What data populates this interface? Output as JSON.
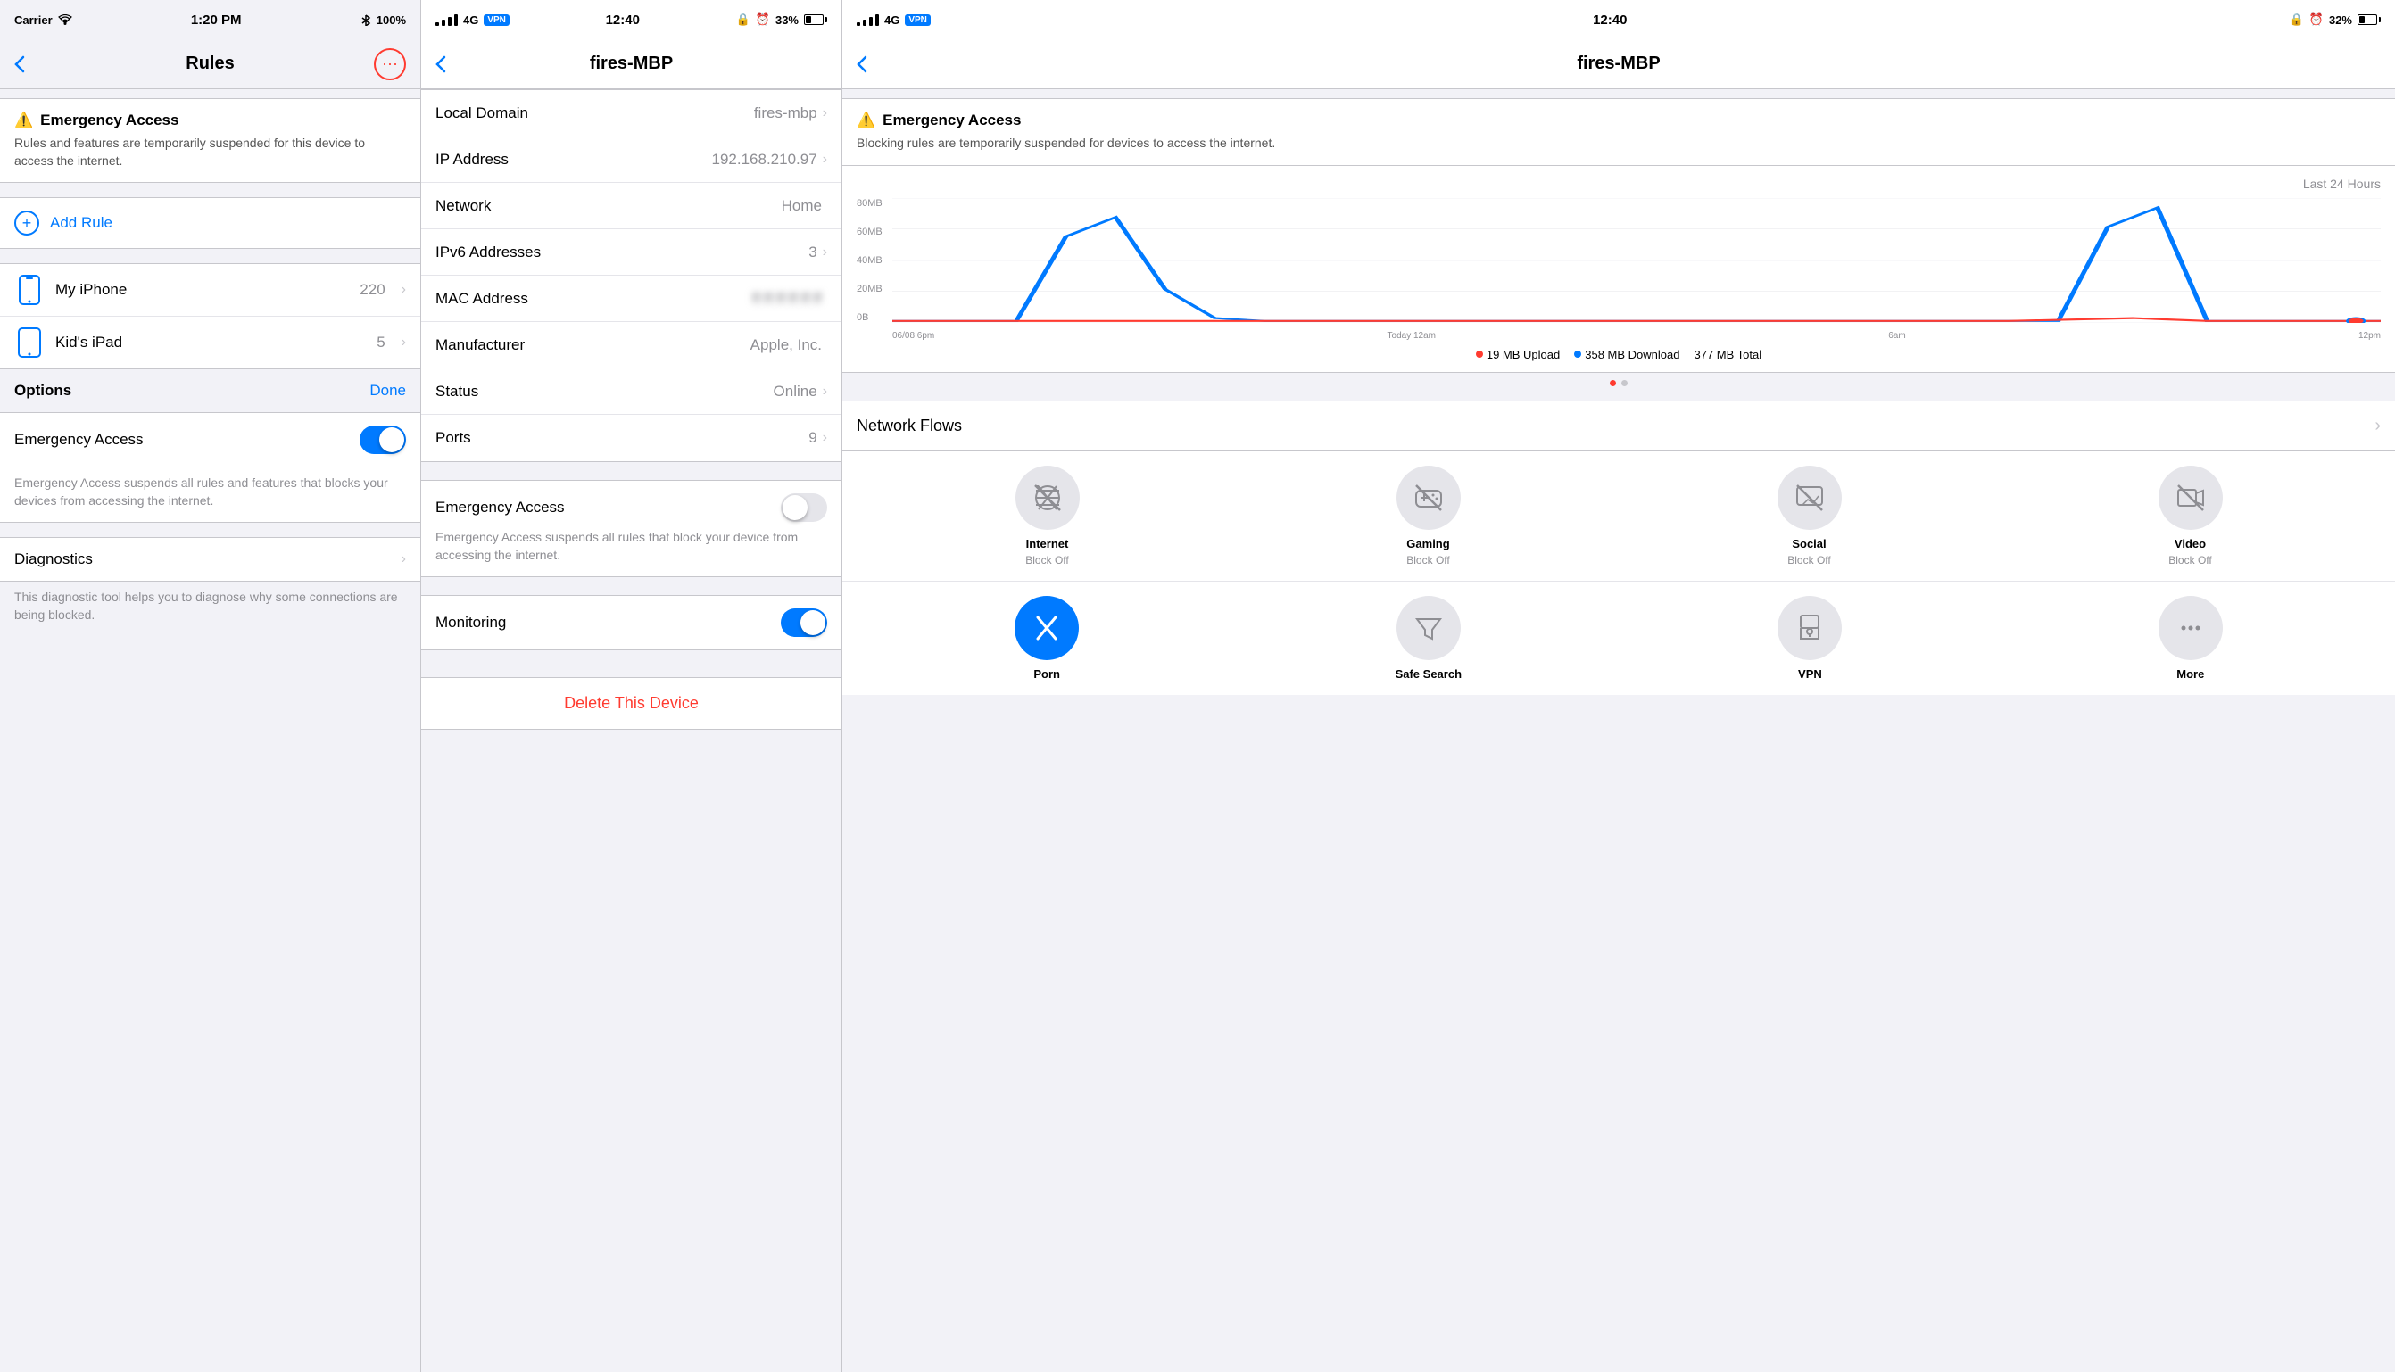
{
  "panel1": {
    "statusBar": {
      "carrier": "Carrier",
      "signal": "●●●●●",
      "wifi": "wifi",
      "time": "1:20 PM",
      "bluetooth": "bluetooth",
      "battery": "100%"
    },
    "navTitle": "Rules",
    "emergencyBanner": {
      "title": "⚠️ Emergency Access",
      "desc": "Rules and features are temporarily suspended for this device to access the internet."
    },
    "addRule": {
      "label": "Add Rule"
    },
    "devices": [
      {
        "name": "My iPhone",
        "icon": "phone",
        "count": "220"
      },
      {
        "name": "Kid's iPad",
        "icon": "tablet",
        "count": "5"
      }
    ],
    "optionsBar": {
      "label": "Options",
      "done": "Done"
    },
    "emergencyAccessSetting": {
      "label": "Emergency Access",
      "desc": "Emergency Access suspends all rules and features that blocks your devices from accessing the internet."
    },
    "diagnostics": {
      "label": "Diagnostics",
      "desc": "This diagnostic tool helps you to diagnose why some connections are being blocked."
    }
  },
  "panel2": {
    "statusBar": {
      "signal": "4G",
      "vpn": "VPN",
      "time": "12:40",
      "battery": "33%"
    },
    "navTitle": "fires-MBP",
    "rows": [
      {
        "label": "Local Domain",
        "value": "fires-mbp",
        "chevron": true
      },
      {
        "label": "IP Address",
        "value": "192.168.210.97",
        "chevron": true
      },
      {
        "label": "Network",
        "value": "Home",
        "chevron": false
      },
      {
        "label": "IPv6 Addresses",
        "value": "3",
        "chevron": true
      },
      {
        "label": "MAC Address",
        "value": "blurred",
        "chevron": false
      },
      {
        "label": "Manufacturer",
        "value": "Apple, Inc.",
        "chevron": false
      },
      {
        "label": "Status",
        "value": "Online",
        "chevron": true
      },
      {
        "label": "Ports",
        "value": "9",
        "chevron": true
      }
    ],
    "emergencyAccess": {
      "label": "Emergency Access",
      "desc": "Emergency Access suspends all rules that block your device from accessing the internet.",
      "toggleState": "off"
    },
    "monitoring": {
      "label": "Monitoring",
      "toggleState": "on"
    },
    "deleteBtn": "Delete This Device"
  },
  "panel3": {
    "statusBar": {
      "signal": "4G",
      "vpn": "VPN",
      "time": "12:40",
      "battery": "32%"
    },
    "navTitle": "fires-MBP",
    "emergencyBanner": {
      "title": "⚠️ Emergency Access",
      "desc": "Blocking rules are temporarily suspended for devices to access the internet."
    },
    "chart": {
      "header": "Last 24 Hours",
      "yLabels": [
        "80MB",
        "60MB",
        "40MB",
        "20MB",
        "0B"
      ],
      "xLabels": [
        "06/08 6pm",
        "Today 12am",
        "6am",
        "12pm"
      ],
      "legend": {
        "upload": "19 MB Upload",
        "download": "358 MB Download",
        "total": "377 MB Total"
      }
    },
    "networkFlows": "Network Flows",
    "blocks": [
      {
        "name": "Internet",
        "status": "Block Off",
        "active": false,
        "icon": "wifi-off"
      },
      {
        "name": "Gaming",
        "status": "Block Off",
        "active": false,
        "icon": "game"
      },
      {
        "name": "Social",
        "status": "Block Off",
        "active": false,
        "icon": "social"
      },
      {
        "name": "Video",
        "status": "Block Off",
        "active": false,
        "icon": "video"
      }
    ],
    "blocks2": [
      {
        "name": "Porn",
        "status": "",
        "active": true,
        "icon": "adult"
      },
      {
        "name": "Safe Search",
        "status": "",
        "active": false,
        "icon": "filter"
      },
      {
        "name": "VPN",
        "status": "",
        "active": false,
        "icon": "vpn"
      },
      {
        "name": "More",
        "status": "",
        "active": false,
        "icon": "more"
      }
    ]
  }
}
